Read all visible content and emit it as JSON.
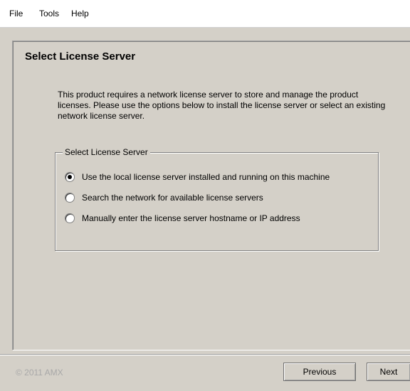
{
  "menu": {
    "items": [
      "File",
      "Tools",
      "Help"
    ]
  },
  "page": {
    "heading": "Select License Server",
    "description": "This product requires a network license server to store and manage the product licenses.  Please use the options below to install the license server or select an existing network license server."
  },
  "group": {
    "legend": "Select License Server",
    "options": [
      {
        "label": "Use the local license server installed and running on this machine",
        "checked": true
      },
      {
        "label": "Search the network for available license servers",
        "checked": false
      },
      {
        "label": "Manually enter the license server hostname or IP address",
        "checked": false
      }
    ]
  },
  "footer": {
    "copyright": "© 2011 AMX",
    "previous_label": "Previous",
    "next_label": "Next"
  }
}
